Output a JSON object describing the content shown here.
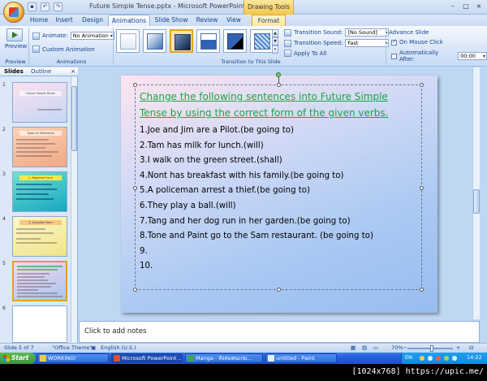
{
  "window": {
    "title": "Future Simple Tense.pptx - Microsoft PowerPoint",
    "contextual_tab_group": "Drawing Tools",
    "controls": [
      "–",
      "□",
      "×"
    ]
  },
  "tabs": [
    {
      "label": "Home",
      "active": false
    },
    {
      "label": "Insert",
      "active": false
    },
    {
      "label": "Design",
      "active": false
    },
    {
      "label": "Animations",
      "active": true
    },
    {
      "label": "Slide Show",
      "active": false
    },
    {
      "label": "Review",
      "active": false
    },
    {
      "label": "View",
      "active": false
    },
    {
      "label": "Format",
      "active": false
    }
  ],
  "ribbon": {
    "preview": {
      "button": "Preview",
      "group": "Preview"
    },
    "animations": {
      "animate_label": "Animate:",
      "animate_value": "No Animation",
      "custom_animation": "Custom Animation",
      "group": "Animations"
    },
    "transition": {
      "sound_label": "Transition Sound:",
      "sound_value": "[No Sound]",
      "speed_label": "Transition Speed:",
      "speed_value": "Fast",
      "apply_all": "Apply To All",
      "group": "Transition to This Slide"
    },
    "advance": {
      "title": "Advance Slide",
      "on_click": "On Mouse Click",
      "on_click_checked": true,
      "after": "Automatically After:",
      "after_checked": false,
      "after_value": "00:00"
    }
  },
  "panel": {
    "tabs": [
      "Slides",
      "Outline"
    ],
    "close": "×",
    "slides": [
      {
        "num": "1",
        "title": "Future Simple Tense",
        "color": "#f3d9e6",
        "selected": false
      },
      {
        "num": "2",
        "title": "Types of Sentences",
        "color": "#f6c3a3",
        "selected": false
      },
      {
        "num": "3",
        "title": "2. Negative Form",
        "color": "#3fd1b8",
        "selected": false
      },
      {
        "num": "4",
        "title": "3. Question form",
        "color": "#f7f0a6",
        "selected": false
      },
      {
        "num": "5",
        "title": "",
        "color": "#d3c4ec",
        "selected": true
      },
      {
        "num": "6",
        "title": "",
        "color": "#ffffff",
        "selected": false
      }
    ]
  },
  "slide": {
    "heading": "Change the following sentences into Future Simple Tense by using the correct form of the  given verbs.",
    "lines": [
      "1.Joe and Jim are a Pilot.(be going to)",
      "2.Tam has milk for lunch.(will)",
      "3.I walk on the green street.(shall)",
      "4.Nont has breakfast with  his family.(be going to)",
      "5.A policeman arrest a thief.(be going to)",
      "6.They play a ball.(will)",
      "7.Tang and her dog run in her garden.(be going to)",
      "8.Tone and Paint go to the Sam restaurant. (be going to)",
      "9.",
      "10."
    ]
  },
  "notes": {
    "placeholder": "Click to add notes"
  },
  "status": {
    "slide_pos": "Slide 5 of 7",
    "theme": "\"Office Theme\"",
    "language": "English (U.S.)",
    "zoom": "70%",
    "zoom_level": 0.7
  },
  "taskbar": {
    "start": "Start",
    "tasks": [
      {
        "label": "WORKING!",
        "color": "#f0c94a",
        "active": false
      },
      {
        "label": "Microsoft PowerPoint ...",
        "color": "#d9532c",
        "active": true
      },
      {
        "label": "Manga - สังคมคนเกม...",
        "color": "#3ca55c",
        "active": false
      },
      {
        "label": "untitled - Paint",
        "color": "#e6f0ff",
        "active": false
      }
    ],
    "tray": {
      "lang": "EN",
      "time": "14:22"
    }
  },
  "caption": "[1024x768] https://upic.me/"
}
